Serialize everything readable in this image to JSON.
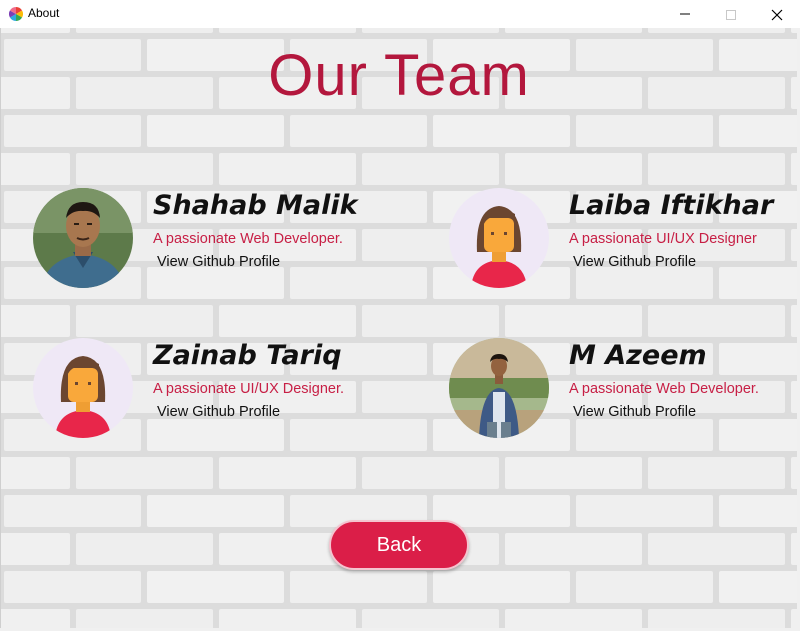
{
  "window": {
    "title": "About",
    "icon": "app-logo-icon",
    "controls": [
      "minimize-icon",
      "maximize-icon",
      "close-icon"
    ]
  },
  "page": {
    "heading": "Our Team",
    "colors": {
      "accent": "#db1e48",
      "heading": "#b3173d",
      "role_text": "#c71f45",
      "background": "#e9e9e9"
    }
  },
  "members": [
    {
      "name": "Shahab Malik",
      "role": "A passionate Web Developer.",
      "link": "View Github Profile",
      "avatar": "photo-avatar"
    },
    {
      "name": "Laiba Iftikhar",
      "role": "A passionate UI/UX Designer",
      "link": "View Github Profile",
      "avatar": "female-avatar-icon"
    },
    {
      "name": "Zainab Tariq",
      "role": "A passionate UI/UX Designer.",
      "link": "View Github Profile",
      "avatar": "female-avatar-icon"
    },
    {
      "name": "M Azeem",
      "role": "A passionate Web Developer.",
      "link": "View Github Profile",
      "avatar": "photo-avatar"
    }
  ],
  "back_button": {
    "label": "Back"
  }
}
